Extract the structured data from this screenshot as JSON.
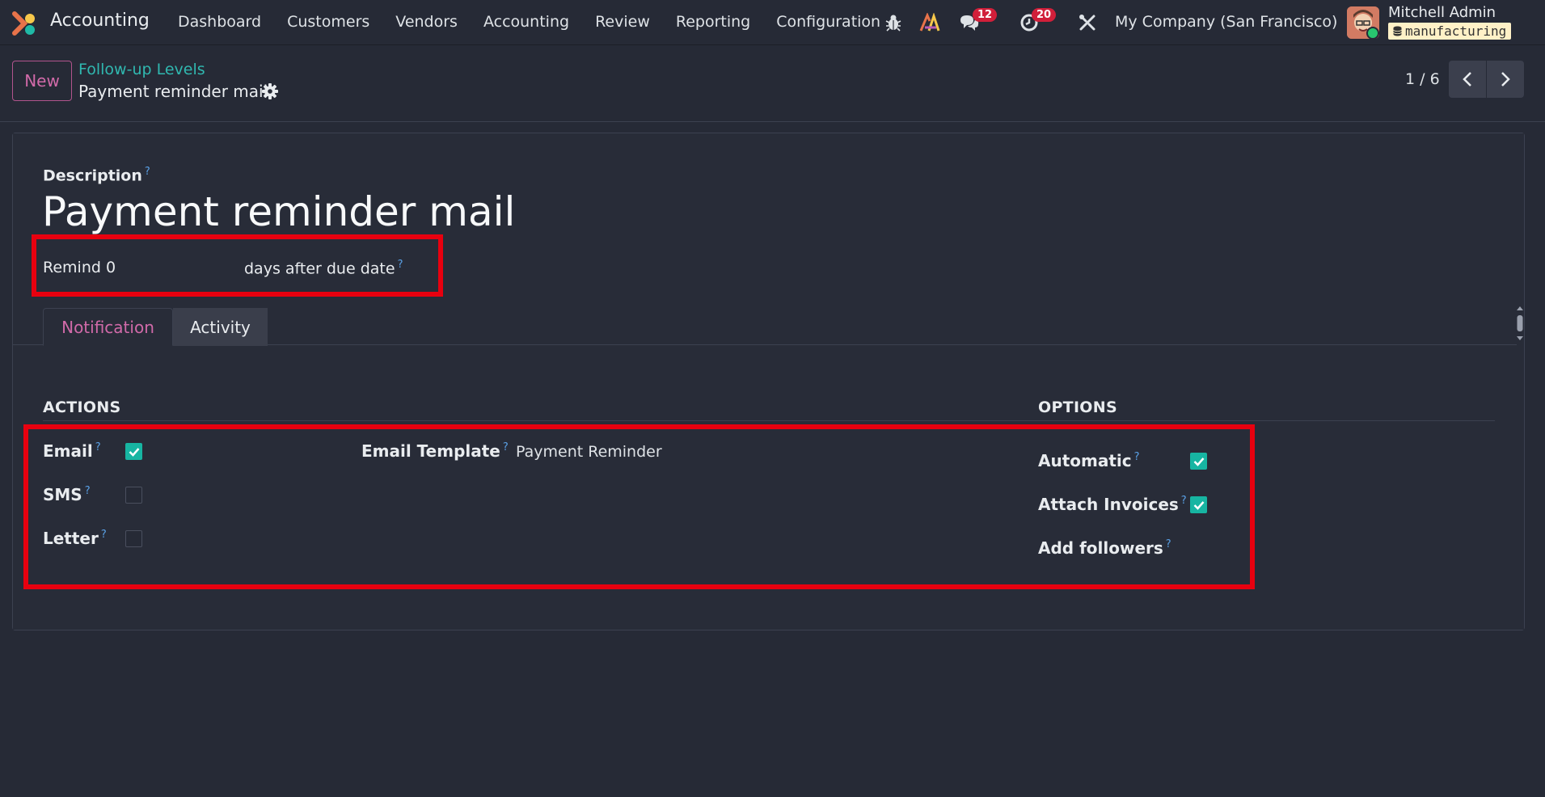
{
  "navbar": {
    "app_name": "Accounting",
    "menu": [
      "Dashboard",
      "Customers",
      "Vendors",
      "Accounting",
      "Review",
      "Reporting",
      "Configuration"
    ],
    "messages_count": "12",
    "activities_count": "20",
    "company": "My Company (San Francisco)",
    "user_name": "Mitchell Admin",
    "database": "manufacturing"
  },
  "control_panel": {
    "new_label": "New",
    "breadcrumb_parent": "Follow-up Levels",
    "breadcrumb_current": "Payment reminder mail",
    "pager": "1 / 6"
  },
  "form": {
    "description_label": "Description",
    "title": "Payment reminder mail",
    "remind_label": "Remind",
    "remind_value": "0",
    "remind_suffix": "days after due date",
    "help_mark": "?",
    "tabs": [
      "Notification",
      "Activity"
    ],
    "actions_title": "ACTIONS",
    "options_title": "OPTIONS",
    "email_label": "Email",
    "email_checked": true,
    "sms_label": "SMS",
    "sms_checked": false,
    "letter_label": "Letter",
    "letter_checked": false,
    "email_template_label": "Email Template",
    "email_template_value": "Payment Reminder",
    "automatic_label": "Automatic",
    "automatic_checked": true,
    "attach_invoices_label": "Attach Invoices",
    "attach_invoices_checked": true,
    "add_followers_label": "Add followers"
  },
  "colors": {
    "accent": "#d16aa9",
    "link": "#30b8b0",
    "checkbox": "#17b5a2",
    "highlight": "#e8000f",
    "badge": "#d11f3a"
  }
}
